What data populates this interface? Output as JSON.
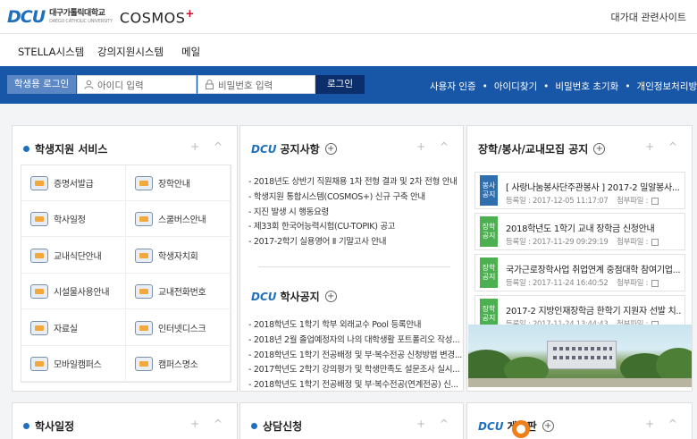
{
  "header": {
    "logo_dcu": "DCU",
    "univ_ko": "대구가톨릭대학교",
    "univ_en": "DAEGU CATHOLIC UNIVERSITY",
    "cosmos": "COSMOS",
    "cosmos_plus": "+",
    "related_sites": "대가대 관련사이트"
  },
  "menu": {
    "items": [
      "STELLA시스템",
      "강의지원시스템",
      "메일"
    ]
  },
  "login": {
    "student_login": "학생용 로그인",
    "id_placeholder": "아이디 입력",
    "pw_placeholder": "비밀번호 입력",
    "login_button": "로그인",
    "links": [
      "사용자 인증",
      "아이디찾기",
      "비밀번호 초기화",
      "개인정보처리방침"
    ],
    "separator": "•"
  },
  "services": {
    "title": "학생지원 서비스",
    "controls": "+ ^",
    "items": [
      "증명서발급",
      "장학안내",
      "학사일정",
      "스쿨버스안내",
      "교내식단안내",
      "학생자치회",
      "시설물사용안내",
      "교내전화번호",
      "자료실",
      "인터넷디스크",
      "모바일캠퍼스",
      "캠퍼스명소"
    ]
  },
  "notices": {
    "dcu": "DCU",
    "title": "공지사항",
    "controls": "+ ^",
    "items": [
      "2018년도 상반기 직원채용 1차 전형 결과 및 2차 전형 안내",
      "학생지원 통합시스템(COSMOS+) 신규 구축 안내",
      "지진 발생 시 행동요령",
      "제33회 한국어능력시험(CU-TOPIK) 공고",
      "2017-2학기 실용영어 Ⅱ 기말고사 안내"
    ]
  },
  "academic": {
    "dcu": "DCU",
    "title": "학사공지",
    "items": [
      "2018학년도 1학기 학부 외래교수 Pool 등록안내",
      "2018년 2월 졸업예정자의 나의 대학생활 포트폴리오 작성...",
      "2018학년도 1학기 전공배정 및 부·복수전공 신청방법 변경...",
      "2017학년도 2학기 강의평가 및 학생만족도 설문조사 실시...",
      "2018학년도 1학기 전공배정 및 부·복수전공(연계전공) 신..."
    ]
  },
  "recruit": {
    "title": "장학/봉사/교내모집 공지",
    "controls": "+ ^",
    "date_label": "등록일 :",
    "attach_label": "첨부파일 :",
    "items": [
      {
        "badge": "봉사 공지",
        "color": "#2f6fae",
        "title": "[ 사랑나눔봉사단주관봉사 ] 2017-2 밀알봉사...",
        "date": "2017-12-05 11:17:07"
      },
      {
        "badge": "장학 공지",
        "color": "#4caf50",
        "title": "2018학년도 1학기 교내 장학금 신청안내",
        "date": "2017-11-29 09:29:19"
      },
      {
        "badge": "장학 공지",
        "color": "#4caf50",
        "title": "국가근로장학사업 취업연계 중점대학 참여기업...",
        "date": "2017-11-24 16:40:52"
      },
      {
        "badge": "장학 공지",
        "color": "#4caf50",
        "title": "2017-2 지방인재장학금 한학기 지원자 선발 치...",
        "date": "2017-11-24 13:44:43"
      }
    ]
  },
  "bottom": {
    "schedule": "학사일정",
    "counsel": "상담신청",
    "board_dcu": "DCU",
    "board": "게시판",
    "controls": "+ ^"
  }
}
